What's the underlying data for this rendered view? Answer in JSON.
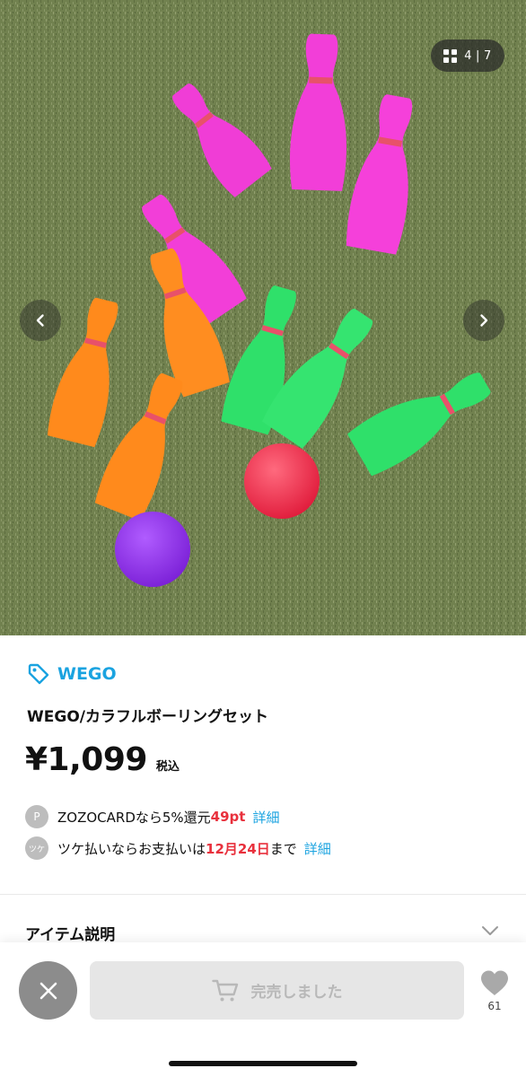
{
  "gallery": {
    "counter_current": "4",
    "counter_separator": "|",
    "counter_total": "7",
    "prev_icon": "chevron-left-icon",
    "next_icon": "chevron-right-icon"
  },
  "product": {
    "brand": "WEGO",
    "title": "WEGO/カラフルボーリングセット",
    "price": "¥1,099",
    "tax_label": "税込"
  },
  "benefits": [
    {
      "badge": "P",
      "pre": "ZOZOCARDなら5%還元 ",
      "highlight": "49pt",
      "post": "",
      "link": "詳細"
    },
    {
      "badge": "ツケ",
      "pre": "ツケ払いならお支払いは",
      "highlight": "12月24日",
      "post": "まで",
      "link": "詳細"
    }
  ],
  "sections": {
    "item_description": "アイテム説明"
  },
  "bottom_bar": {
    "sold_out_label": "完売しました",
    "favorite_count": "61"
  },
  "colors": {
    "accent_blue": "#1aa3e0",
    "highlight_red": "#e8303c",
    "disabled_bg": "#e6e6e6"
  }
}
